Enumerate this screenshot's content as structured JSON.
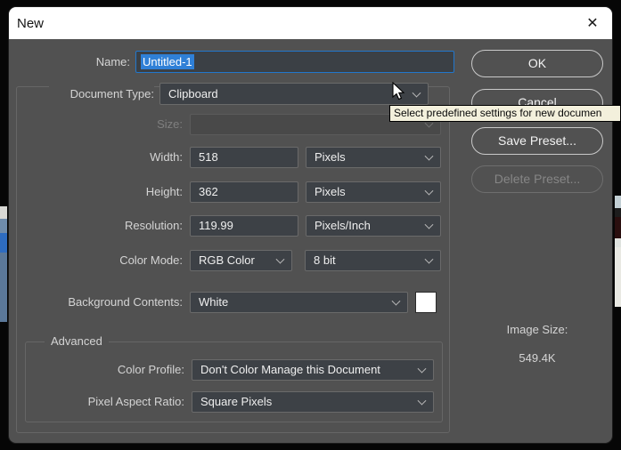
{
  "dialog": {
    "title": "New",
    "close_icon": "✕"
  },
  "fields": {
    "name": {
      "label": "Name:",
      "value": "Untitled-1"
    },
    "document_type": {
      "label": "Document Type:",
      "value": "Clipboard"
    },
    "size": {
      "label": "Size:",
      "value": ""
    },
    "width": {
      "label": "Width:",
      "value": "518",
      "unit": "Pixels"
    },
    "height": {
      "label": "Height:",
      "value": "362",
      "unit": "Pixels"
    },
    "resolution": {
      "label": "Resolution:",
      "value": "119.99",
      "unit": "Pixels/Inch"
    },
    "color_mode": {
      "label": "Color Mode:",
      "value": "RGB Color",
      "depth": "8 bit"
    },
    "background_contents": {
      "label": "Background Contents:",
      "value": "White",
      "swatch_color": "#ffffff"
    },
    "advanced": {
      "legend": "Advanced",
      "color_profile": {
        "label": "Color Profile:",
        "value": "Don't Color Manage this Document"
      },
      "pixel_aspect_ratio": {
        "label": "Pixel Aspect Ratio:",
        "value": "Square Pixels"
      }
    }
  },
  "buttons": {
    "ok": "OK",
    "cancel": "Cancel",
    "save_preset": "Save Preset...",
    "delete_preset": "Delete Preset..."
  },
  "image_size": {
    "label": "Image Size:",
    "value": "549.4K"
  },
  "tooltip": {
    "text": "Select predefined settings for new documen"
  },
  "colors": {
    "selection": "#2f80d7",
    "tooltip_bg": "#f3f0dc",
    "title_bar": "#ffffff",
    "dialog_bg": "#515151"
  }
}
